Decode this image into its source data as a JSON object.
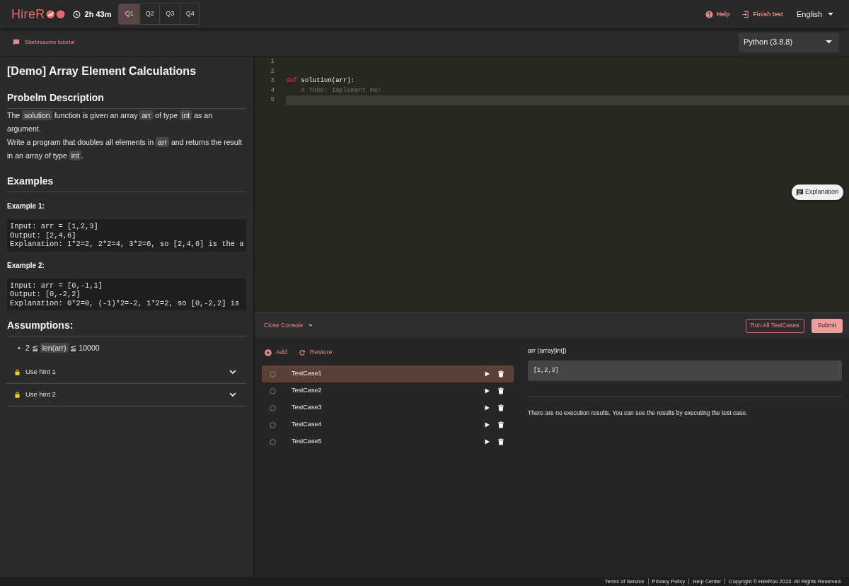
{
  "header": {
    "logo": "HireR",
    "timer": "2h 43m",
    "question_tabs": [
      {
        "label": "Q1",
        "selected": true
      },
      {
        "label": "Q2",
        "selected": false
      },
      {
        "label": "Q3",
        "selected": false
      },
      {
        "label": "Q4",
        "selected": false
      }
    ],
    "help": "Help",
    "finish": "Finish test",
    "language": "English"
  },
  "toolbar": {
    "tutorial": "Start/resume tutorial",
    "runtime": "Python (3.8.8)"
  },
  "problem": {
    "title": "[Demo] Array Element Calculations",
    "description_heading": "Probelm Description",
    "description": [
      [
        {
          "kind": "text",
          "text": "The "
        },
        {
          "kind": "code",
          "text": "solution"
        },
        {
          "kind": "text",
          "text": " function is given an array "
        },
        {
          "kind": "code",
          "text": "arr"
        },
        {
          "kind": "text",
          "text": " of type "
        },
        {
          "kind": "code",
          "text": "int"
        },
        {
          "kind": "text",
          "text": " as an argument."
        }
      ],
      [
        {
          "kind": "text",
          "text": "Write a program that doubles all elements in "
        },
        {
          "kind": "code",
          "text": "arr"
        },
        {
          "kind": "text",
          "text": " and returns the result in an array of type "
        },
        {
          "kind": "code",
          "text": "int"
        },
        {
          "kind": "text",
          "text": "."
        }
      ]
    ],
    "examples_heading": "Examples",
    "examples": [
      {
        "title": "Example 1:",
        "code": [
          "Input: arr = [1,2,3]",
          "Output: [2,4,6]",
          "Explanation: 1*2=2, 2*2=4, 3*2=6, so [2,4,6] is the a"
        ]
      },
      {
        "title": "Example 2:",
        "code": [
          "Input: arr = [0,-1,1]",
          "Output: [0,-2,2]",
          "Explanation: 0*2=0, (-1)*2=-2, 1*2=2, so [0,-2,2] is"
        ]
      }
    ],
    "assumptions_heading": "Assumptions:",
    "assumptions": [
      {
        "bullet": "•",
        "segments": [
          {
            "kind": "text",
            "text": "2 ≦ "
          },
          {
            "kind": "code",
            "text": "len(arr)"
          },
          {
            "kind": "text",
            "text": " ≦ 10000"
          }
        ]
      }
    ],
    "hints": [
      {
        "label": "Use hint 1",
        "locked": true,
        "expanded": false
      },
      {
        "label": "Use hint 2",
        "locked": true,
        "expanded": false
      }
    ]
  },
  "editor": {
    "lines": [
      {
        "number": "1",
        "active": false
      },
      {
        "number": "2",
        "active": false
      },
      {
        "number": "3",
        "active": false,
        "tokens": [
          {
            "kind": "keyword",
            "text": "def"
          },
          {
            "kind": "plain",
            "text": " solution(arr):"
          }
        ]
      },
      {
        "number": "4",
        "active": false,
        "tokens": [
          {
            "kind": "comment",
            "text": "    # TODO: Implement me!"
          }
        ]
      },
      {
        "number": "5",
        "active": true
      }
    ],
    "explanation_button": "Explanation"
  },
  "console": {
    "toggle": "Close Console",
    "run_all": "Run All TestCases",
    "submit": "Submit",
    "add": "Add",
    "restore": "Restore",
    "test_cases": [
      {
        "name": "TestCase1",
        "selected": true
      },
      {
        "name": "TestCase2",
        "selected": false
      },
      {
        "name": "TestCase3",
        "selected": false
      },
      {
        "name": "TestCase4",
        "selected": false
      },
      {
        "name": "TestCase5",
        "selected": false
      }
    ],
    "input": {
      "label": "arr (array[int])",
      "value": "[1,2,3]"
    },
    "result_message": "There are no execution results. You can see the results by executing the test case."
  },
  "footer": {
    "links": [
      "Terms of Service",
      "Privacy Policy",
      "Help Center"
    ],
    "copyright": "Copyright © HireRoo 2023. All Rights Reserved."
  }
}
